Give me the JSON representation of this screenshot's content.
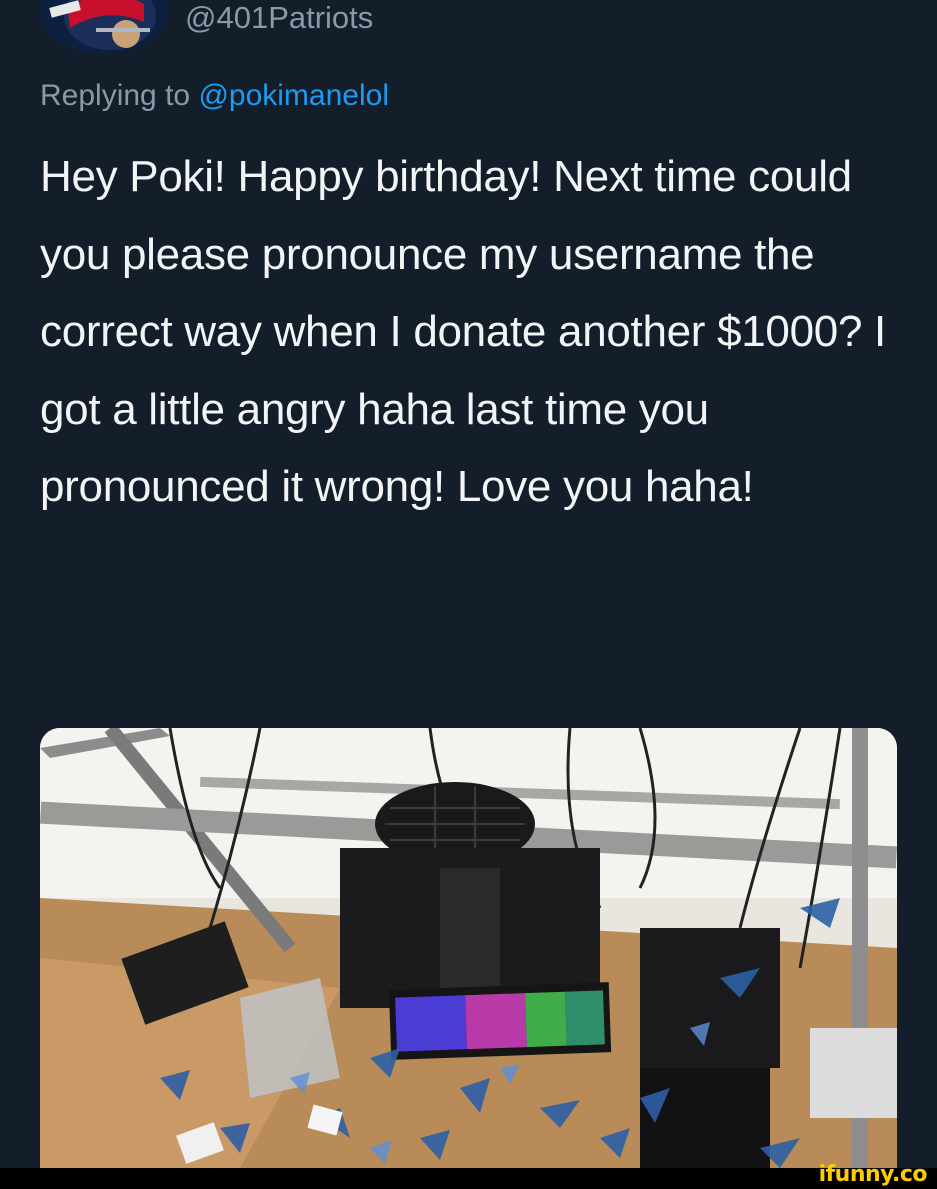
{
  "tweet": {
    "handle": "@401Patriots",
    "reply_prefix": "Replying to ",
    "reply_to": "@pokimanelol",
    "text": "Hey Poki! Happy birthday! Next time could you please pronounce my username the correct way when I donate another $1000? I got a little angry haha last time you pronounced it wrong! Love you haha!",
    "avatar_icon": "patriots-helmet-icon",
    "media_description_icon": "smashed-desk-photo"
  },
  "watermark": {
    "text": "ifunny.co"
  },
  "colors": {
    "background": "#141d2a",
    "muted_text": "#8b98a5",
    "mention": "#1d9bf0",
    "watermark": "#ffcc00"
  }
}
